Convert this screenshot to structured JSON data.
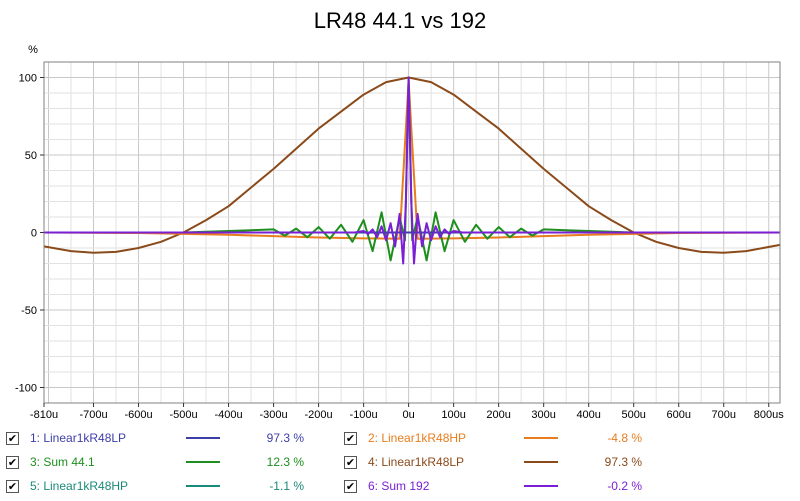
{
  "chart_data": {
    "type": "line",
    "title": "LR48 44.1 vs 192",
    "ylabel": "%",
    "xlabel": "",
    "xlim": [
      -810,
      825
    ],
    "ylim": [
      -110,
      110
    ],
    "x_unit": "us",
    "x_ticks": [
      {
        "value": -810,
        "label": "-810u"
      },
      {
        "value": -700,
        "label": "-700u"
      },
      {
        "value": -600,
        "label": "-600u"
      },
      {
        "value": -500,
        "label": "-500u"
      },
      {
        "value": -400,
        "label": "-400u"
      },
      {
        "value": -300,
        "label": "-300u"
      },
      {
        "value": -200,
        "label": "-200u"
      },
      {
        "value": -100,
        "label": "-100u"
      },
      {
        "value": 0,
        "label": "0u"
      },
      {
        "value": 100,
        "label": "100u"
      },
      {
        "value": 200,
        "label": "200u"
      },
      {
        "value": 300,
        "label": "300u"
      },
      {
        "value": 400,
        "label": "400u"
      },
      {
        "value": 500,
        "label": "500u"
      },
      {
        "value": 600,
        "label": "600u"
      },
      {
        "value": 700,
        "label": "700u"
      },
      {
        "value": 800,
        "label": "800us"
      }
    ],
    "y_ticks": [
      {
        "value": 100,
        "label": "100"
      },
      {
        "value": 50,
        "label": "50"
      },
      {
        "value": 0,
        "label": "0"
      },
      {
        "value": -50,
        "label": "-50"
      },
      {
        "value": -100,
        "label": "-100"
      }
    ],
    "grid": true,
    "legend_position": "bottom",
    "series": [
      {
        "name": "1: Linear1kR48LP",
        "color": "#3d3fa8",
        "legend_value": "97.3 %",
        "visible": true,
        "x": [
          -810,
          -600,
          -400,
          -200,
          -100,
          -50,
          -20,
          0,
          20,
          50,
          100,
          200,
          400,
          600,
          825
        ],
        "y": [
          0,
          0,
          0,
          0,
          0,
          0,
          0,
          0,
          0,
          0,
          0,
          0,
          0,
          0,
          0
        ]
      },
      {
        "name": "2: Linear1kR48HP",
        "color": "#e87d1e",
        "legend_value": "-4.8 %",
        "visible": true,
        "x": [
          -810,
          -600,
          -400,
          -300,
          -200,
          -100,
          -20,
          0,
          20,
          100,
          200,
          300,
          400,
          600,
          825
        ],
        "y": [
          0,
          -0.3,
          -1.5,
          -2.3,
          -3.2,
          -3.8,
          -4,
          98,
          -4,
          -3.8,
          -3.2,
          -2.3,
          -1.5,
          -0.3,
          0
        ]
      },
      {
        "name": "3: Sum 44.1",
        "color": "#1e8f1e",
        "legend_value": "12.3 %",
        "visible": true,
        "x": [
          -500,
          -450,
          -400,
          -350,
          -300,
          -275,
          -250,
          -225,
          -200,
          -175,
          -150,
          -125,
          -100,
          -80,
          -60,
          -40,
          -20,
          -8,
          0,
          8,
          20,
          40,
          60,
          80,
          100,
          125,
          150,
          175,
          200,
          225,
          250,
          275,
          300,
          350,
          400,
          450,
          500
        ],
        "y": [
          0,
          0.5,
          1,
          1.5,
          2,
          -2,
          2.5,
          -3,
          3.5,
          -4,
          5,
          -6,
          8,
          -12,
          13,
          -18,
          10,
          -5,
          100,
          -5,
          10,
          -18,
          13,
          -12,
          8,
          -6,
          5,
          -4,
          3.5,
          -3,
          2.5,
          -2,
          2,
          1.5,
          1,
          0.5,
          0
        ]
      },
      {
        "name": "4: Linear1kR48LP",
        "color": "#8b4a1a",
        "legend_value": "97.3 %",
        "visible": true,
        "x": [
          -810,
          -750,
          -700,
          -650,
          -600,
          -550,
          -500,
          -450,
          -400,
          -350,
          -300,
          -250,
          -200,
          -150,
          -100,
          -50,
          0,
          50,
          100,
          150,
          200,
          250,
          300,
          350,
          400,
          450,
          500,
          550,
          600,
          650,
          700,
          750,
          825
        ],
        "y": [
          -9,
          -12,
          -13,
          -12.5,
          -10,
          -6,
          0,
          8,
          17,
          29,
          41,
          54,
          67,
          78,
          89,
          97,
          100,
          97,
          89,
          78,
          67,
          54,
          41,
          29,
          17,
          8,
          0,
          -6,
          -10,
          -12.5,
          -13,
          -12,
          -8
        ]
      },
      {
        "name": "5: Linear1kR48HP",
        "color": "#1a8a7a",
        "legend_value": "-1.1 %",
        "visible": true,
        "x": [
          -810,
          -400,
          -200,
          -50,
          0,
          50,
          200,
          400,
          825
        ],
        "y": [
          0,
          0,
          0,
          0,
          0,
          0,
          0,
          0,
          0
        ]
      },
      {
        "name": "6: Sum 192",
        "color": "#7a1fd6",
        "legend_value": "-0.2 %",
        "visible": true,
        "x": [
          -810,
          -400,
          -120,
          -100,
          -90,
          -80,
          -70,
          -60,
          -50,
          -40,
          -30,
          -20,
          -12,
          -6,
          0,
          6,
          12,
          20,
          30,
          40,
          50,
          60,
          70,
          80,
          90,
          100,
          120,
          400,
          825
        ],
        "y": [
          0,
          0,
          0,
          1,
          -1,
          2,
          -3,
          4,
          -5,
          6,
          -9,
          12,
          -20,
          20,
          100,
          20,
          -20,
          12,
          -9,
          6,
          -5,
          4,
          -3,
          2,
          -1,
          1,
          0,
          0,
          0
        ]
      }
    ]
  }
}
